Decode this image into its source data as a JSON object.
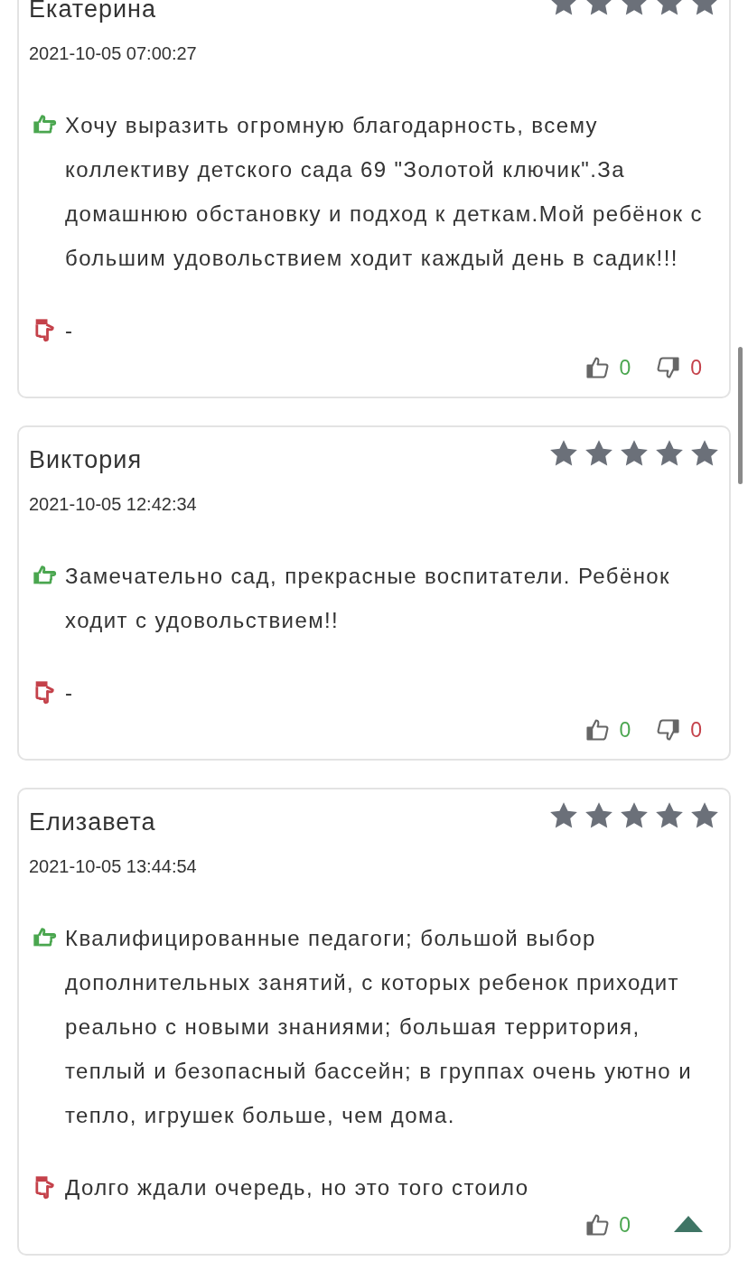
{
  "reviews": [
    {
      "author": "Екатерина",
      "stars": 5,
      "date": "2021-10-05 07:00:27",
      "pros": "Хочу выразить огромную благодарность, всему коллективу детского сада 69 \"Золотой ключик\".За домашнюю обстановку и подход к деткам.Мой ребёнок с большим удовольствием ходит каждый день в садик!!!",
      "cons": "-",
      "likes": "0",
      "dislikes": "0"
    },
    {
      "author": "Виктория",
      "stars": 5,
      "date": "2021-10-05 12:42:34",
      "pros": "Замечательно сад, прекрасные воспитатели. Ребёнок ходит с удовольствием!!",
      "cons": "-",
      "likes": "0",
      "dislikes": "0"
    },
    {
      "author": "Елизавета",
      "stars": 5,
      "date": "2021-10-05 13:44:54",
      "pros": "Квалифицированные педагоги; большой выбор дополнительных занятий, с которых ребенок приходит реально с новыми знаниями; большая территория, теплый и безопасный бассейн; в группах очень уютно и тепло, игрушек больше, чем дома.",
      "cons": "Долго ждали очередь, но это того стоило",
      "likes": "0"
    }
  ]
}
